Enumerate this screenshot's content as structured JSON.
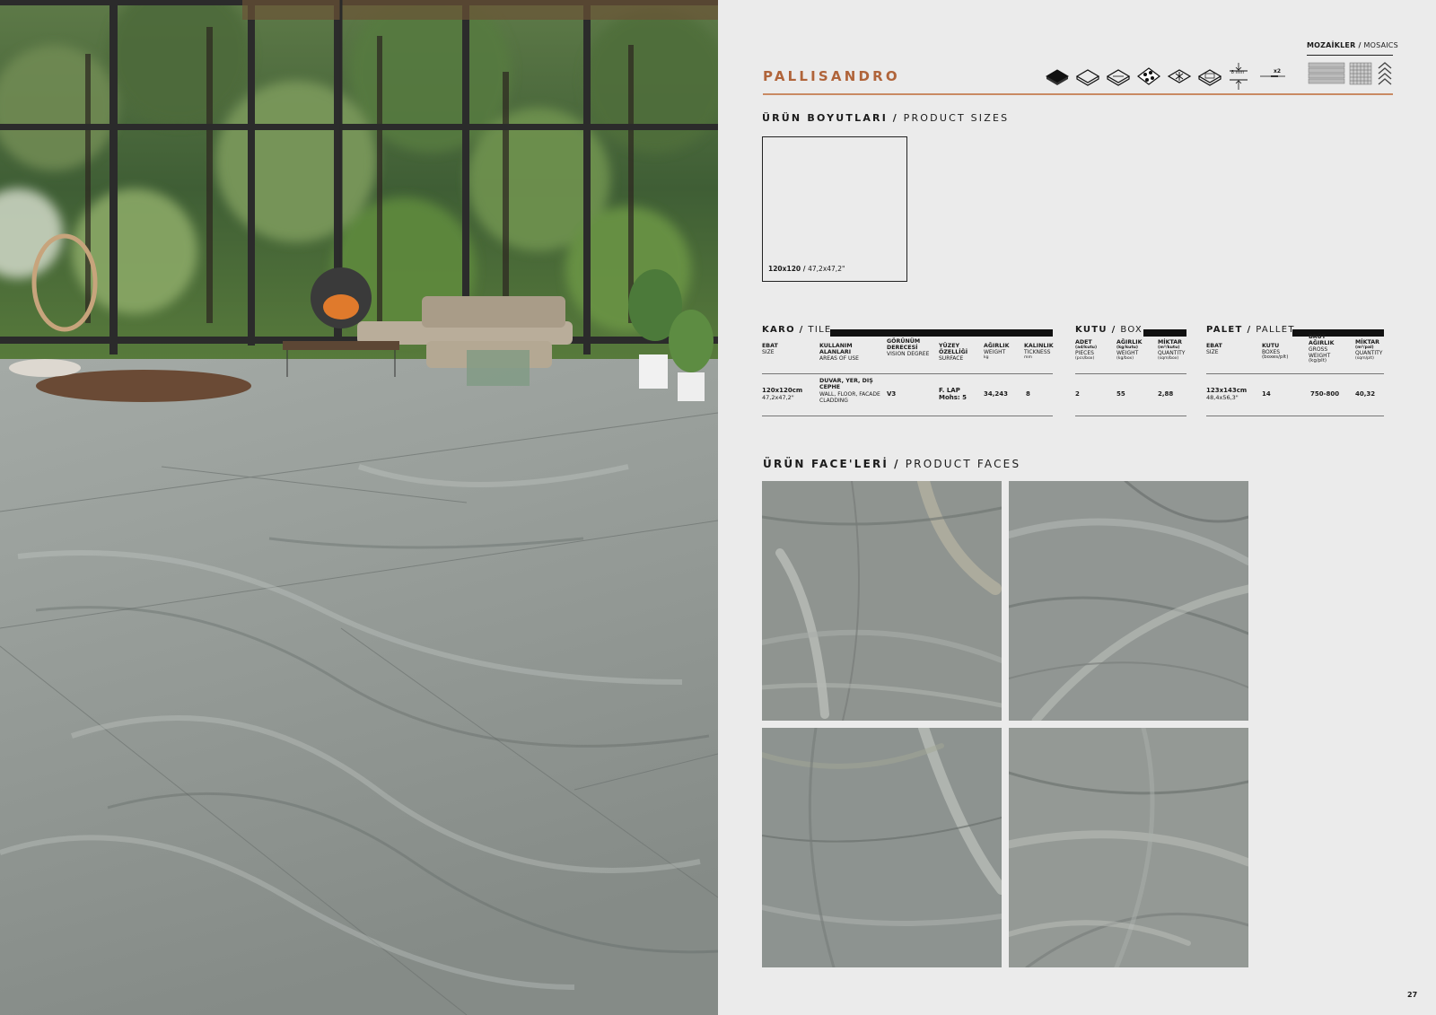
{
  "product": {
    "name": "PALLISANDRO"
  },
  "mosaics": {
    "label_tr": "MOZAİKLER",
    "label_en": "MOSAICS"
  },
  "icons": {
    "features": [
      "full-body-tile-icon",
      "glazed-tile-icon",
      "matt-surface-icon",
      "anti-slip-icon",
      "frost-resistant-icon",
      "rectified-icon",
      "thickness-8mm-icon",
      "shade-variation-icon"
    ],
    "thickness_text": "8 mm",
    "variation_text": "x2",
    "mosaics": [
      "strip-mosaic-icon",
      "grid-mosaic-icon",
      "chevron-mosaic-icon"
    ]
  },
  "sizes": {
    "title_tr": "ÜRÜN BOYUTLARI",
    "title_en": "PRODUCT SIZES",
    "tile": {
      "label_bold": "120x120",
      "label_thin": "47,2x47,2\""
    }
  },
  "tables": {
    "karo": {
      "title_tr": "KARO",
      "title_en": "TILE",
      "headers": [
        {
          "tr": "EBAT",
          "en": "SIZE",
          "unit": ""
        },
        {
          "tr": "KULLANIM ALANLARI",
          "en": "AREAS OF USE",
          "unit": ""
        },
        {
          "tr": "GÖRÜNÜM DERECESİ",
          "en": "VISION DEGREE",
          "unit": ""
        },
        {
          "tr": "YÜZEY ÖZELLİĞİ",
          "en": "SURFACE",
          "unit": ""
        },
        {
          "tr": "AĞIRLIK",
          "en": "WEIGHT",
          "unit": "kg"
        },
        {
          "tr": "KALINLIK",
          "en": "TICKNESS",
          "unit": "mm"
        }
      ],
      "values": {
        "size": "120x120cm",
        "size_inch": "47,2x47,2\"",
        "areas_bold": "DUVAR, YER, DIŞ CEPHE",
        "areas_thin": "WALL, FLOOR, FACADE CLADDING",
        "vision": "V3",
        "surface_1": "F. LAP",
        "surface_2": "Mohs: 5",
        "weight": "34,243",
        "thickness": "8"
      }
    },
    "kutu": {
      "title_tr": "KUTU",
      "title_en": "BOX",
      "headers": [
        {
          "tr": "ADET",
          "unit_tr": "(ad/kutu)",
          "en": "PIECES",
          "unit": "(pcs/box)"
        },
        {
          "tr": "AĞIRLIK",
          "unit_tr": "(kg/kutu)",
          "en": "WEIGHT",
          "unit": "(kg/box)"
        },
        {
          "tr": "MİKTAR",
          "unit_tr": "(m²/kutu)",
          "en": "QUANTITY",
          "unit": "(sqm/box)"
        }
      ],
      "values": {
        "pieces": "2",
        "weight": "55",
        "quantity": "2,88"
      }
    },
    "palet": {
      "title_tr": "PALET",
      "title_en": "PALLET",
      "headers": [
        {
          "tr": "EBAT",
          "en": "SIZE",
          "unit": ""
        },
        {
          "tr": "KUTU",
          "en": "BOXES",
          "unit": "(boxes/plt)"
        },
        {
          "tr": "BRÜT AĞIRLIK",
          "en": "GROSS WEIGHT",
          "unit": "(kg/plt)"
        },
        {
          "tr": "MİKTAR",
          "unit_tr": "(m²/pal)",
          "en": "QUANTITY",
          "unit": "(sqm/plt)"
        }
      ],
      "values": {
        "size": "123x143cm",
        "size_inch": "48,4x56,3\"",
        "boxes": "14",
        "gross": "750-800",
        "quantity": "40,32"
      }
    }
  },
  "faces": {
    "title_tr": "ÜRÜN FACE'LERİ",
    "title_en": "PRODUCT FACES",
    "count": 4
  },
  "page_number": "27",
  "colors": {
    "brand": "#b0643a",
    "brand_rule": "#c98a63",
    "background": "#ebebeb",
    "marble": "#8c918e"
  }
}
